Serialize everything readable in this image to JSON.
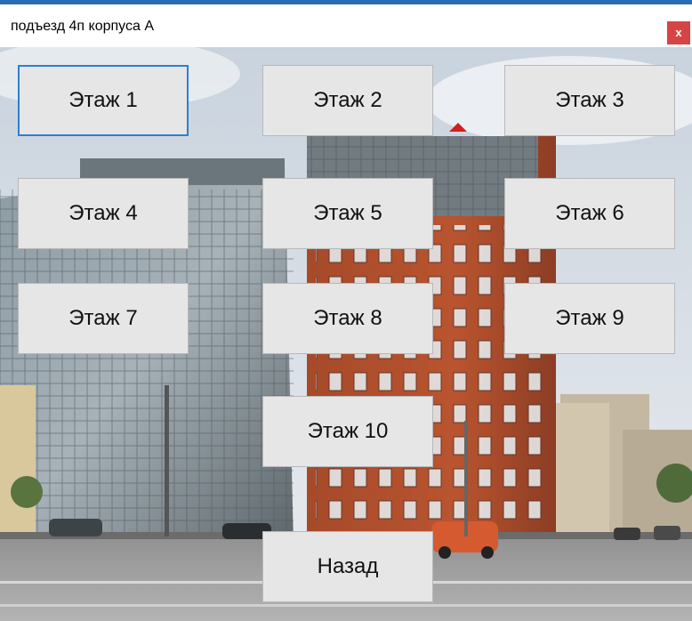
{
  "window": {
    "title": "подъезд 4п корпуса А",
    "close_label": "x"
  },
  "floors": [
    {
      "label": "Этаж 1"
    },
    {
      "label": "Этаж 2"
    },
    {
      "label": "Этаж 3"
    },
    {
      "label": "Этаж 4"
    },
    {
      "label": "Этаж 5"
    },
    {
      "label": "Этаж 6"
    },
    {
      "label": "Этаж 7"
    },
    {
      "label": "Этаж 8"
    },
    {
      "label": "Этаж 9"
    },
    {
      "label": "Этаж 10"
    }
  ],
  "back_label": "Назад",
  "colors": {
    "accent_focus": "#2f7fd0",
    "close_button": "#d64545",
    "button_face": "#e6e6e6"
  }
}
